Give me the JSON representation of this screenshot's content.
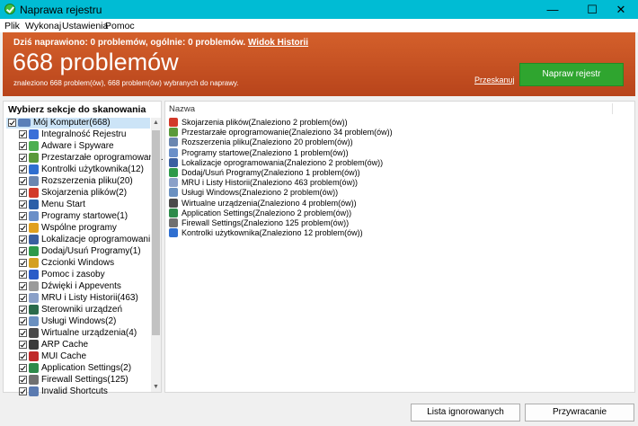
{
  "window": {
    "title": "Naprawa rejestru",
    "minimize": "—",
    "maximize": "☐",
    "close": "✕"
  },
  "menu": [
    "Plik",
    "Wykonaj",
    "Ustawienia",
    "Pomoc"
  ],
  "header": {
    "summary": "Dziś naprawiono: 0 problemów, ogólnie: 0 problemów.",
    "history_link": "Widok Historii",
    "big_count": "668 problemów",
    "subtitle": "znaleziono 668 problem(ów), 668 problem(ów) wybranych do naprawy.",
    "rescan_link": "Przeskanuj",
    "fix_button": "Napraw rejestr",
    "colors": {
      "accent": "#c5512a",
      "fix": "#2fa52f"
    }
  },
  "left_pane": {
    "title": "Wybierz sekcje do skanowania",
    "root": {
      "label": "Mój Komputer(668)",
      "icon": "computer-icon"
    },
    "items": [
      {
        "label": "Integralność Rejestru",
        "icon": "registry-icon",
        "color": "#3a6fd8"
      },
      {
        "label": "Adware i Spyware",
        "icon": "shield-icon",
        "color": "#4caf50"
      },
      {
        "label": "Przestarzałe oprogramowani...",
        "icon": "trash-icon",
        "color": "#5a9a3a"
      },
      {
        "label": "Kontrolki użytkownika(12)",
        "icon": "controls-icon",
        "color": "#2f6fd0"
      },
      {
        "label": "Rozszerzenia pliku(20)",
        "icon": "file-ext-icon",
        "color": "#6a86b0"
      },
      {
        "label": "Skojarzenia plików(2)",
        "icon": "file-assoc-icon",
        "color": "#d23a2a"
      },
      {
        "label": "Menu Start",
        "icon": "start-menu-icon",
        "color": "#2b5fa8"
      },
      {
        "label": "Programy startowe(1)",
        "icon": "startup-icon",
        "color": "#6a8fc8"
      },
      {
        "label": "Wspólne programy",
        "icon": "shared-icon",
        "color": "#e0a020"
      },
      {
        "label": "Lokalizacje oprogramowani...",
        "icon": "folder-icon",
        "color": "#3a5fa0"
      },
      {
        "label": "Dodaj/Usuń Programy(1)",
        "icon": "add-remove-icon",
        "color": "#2e9a4a"
      },
      {
        "label": "Czcionki Windows",
        "icon": "font-icon",
        "color": "#d4a020"
      },
      {
        "label": "Pomoc i zasoby",
        "icon": "help-icon",
        "color": "#2a5cc8"
      },
      {
        "label": "Dźwięki i Appevents",
        "icon": "sound-icon",
        "color": "#9a9a9a"
      },
      {
        "label": "MRU i Listy Historii(463)",
        "icon": "history-icon",
        "color": "#8aa0c8"
      },
      {
        "label": "Sterowniki urządzeń",
        "icon": "driver-icon",
        "color": "#2a6a4a"
      },
      {
        "label": "Usługi Windows(2)",
        "icon": "services-icon",
        "color": "#6a90c0"
      },
      {
        "label": "Wirtualne urządzenia(4)",
        "icon": "virtual-icon",
        "color": "#4a4a4a"
      },
      {
        "label": "ARP Cache",
        "icon": "arp-icon",
        "color": "#3a3a3a"
      },
      {
        "label": "MUI Cache",
        "icon": "mui-icon",
        "color": "#c02a2a"
      },
      {
        "label": "Application Settings(2)",
        "icon": "app-settings-icon",
        "color": "#2e8a4a"
      },
      {
        "label": "Firewall Settings(125)",
        "icon": "firewall-icon",
        "color": "#707070"
      },
      {
        "label": "Invalid Shortcuts",
        "icon": "shortcut-icon",
        "color": "#5a7ab0"
      }
    ]
  },
  "right_pane": {
    "column": "Nazwa",
    "rows": [
      {
        "label": "Skojarzenia plików(Znaleziono 2 problem(ów))",
        "icon": "file-assoc-icon",
        "color": "#d23a2a"
      },
      {
        "label": "Przestarzałe oprogramowanie(Znaleziono 34 problem(ów))",
        "icon": "trash-icon",
        "color": "#5a9a3a"
      },
      {
        "label": "Rozszerzenia pliku(Znaleziono 20 problem(ów))",
        "icon": "file-ext-icon",
        "color": "#6a86b0"
      },
      {
        "label": "Programy startowe(Znaleziono 1 problem(ów))",
        "icon": "startup-icon",
        "color": "#6a8fc8"
      },
      {
        "label": "Lokalizacje oprogramowania(Znaleziono 2 problem(ów))",
        "icon": "folder-icon",
        "color": "#3a5fa0"
      },
      {
        "label": "Dodaj/Usuń Programy(Znaleziono 1 problem(ów))",
        "icon": "add-remove-icon",
        "color": "#2e9a4a"
      },
      {
        "label": "MRU i Listy Historii(Znaleziono 463 problem(ów))",
        "icon": "history-icon",
        "color": "#8aa0c8"
      },
      {
        "label": "Usługi Windows(Znaleziono 2 problem(ów))",
        "icon": "services-icon",
        "color": "#6a90c0"
      },
      {
        "label": "Wirtualne urządzenia(Znaleziono 4 problem(ów))",
        "icon": "virtual-icon",
        "color": "#4a4a4a"
      },
      {
        "label": "Application Settings(Znaleziono 2 problem(ów))",
        "icon": "app-settings-icon",
        "color": "#2e8a4a"
      },
      {
        "label": "Firewall Settings(Znaleziono 125 problem(ów))",
        "icon": "firewall-icon",
        "color": "#707070"
      },
      {
        "label": "Kontrolki użytkownika(Znaleziono 12 problem(ów))",
        "icon": "controls-icon",
        "color": "#2f6fd0"
      }
    ]
  },
  "footer": {
    "ignored_button": "Lista ignorowanych",
    "restore_button": "Przywracanie"
  }
}
